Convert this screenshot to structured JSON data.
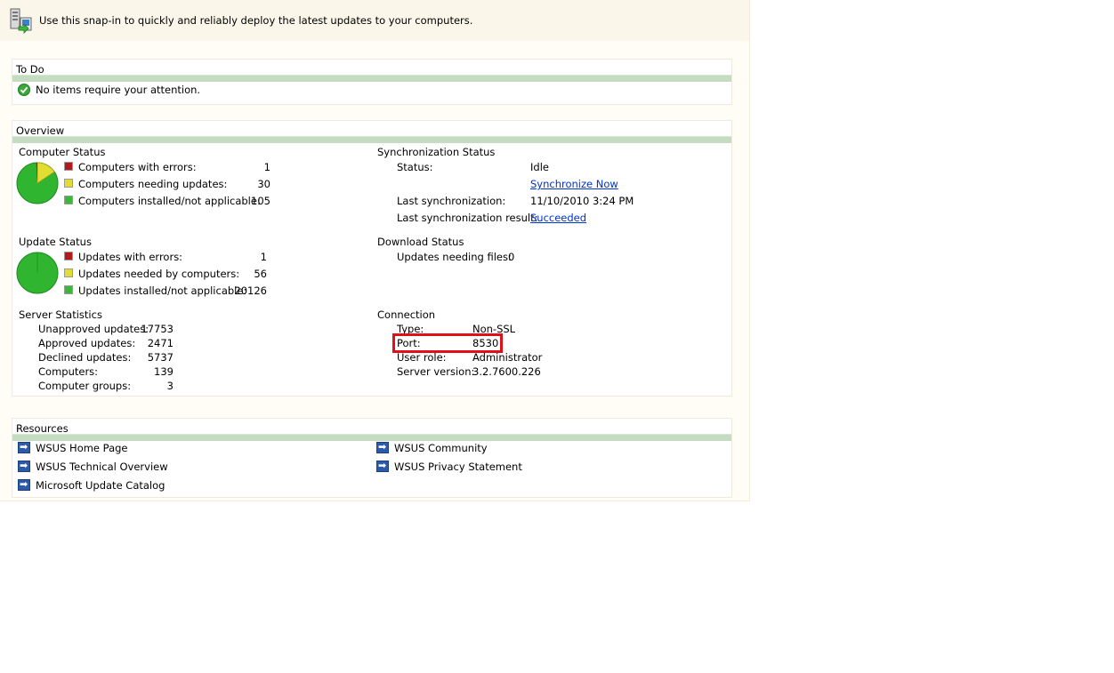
{
  "banner": {
    "text": "Use this snap-in to quickly and reliably deploy the latest updates to your computers."
  },
  "todo": {
    "title": "To Do",
    "message": "No items require your attention."
  },
  "overview": {
    "title": "Overview",
    "computer_status": {
      "title": "Computer Status",
      "items": [
        {
          "label": "Computers with errors:",
          "value": "1",
          "color": "#b01a1a"
        },
        {
          "label": "Computers needing updates:",
          "value": "30",
          "color": "#e3dc32"
        },
        {
          "label": "Computers installed/not applicable:",
          "value": "105",
          "color": "#3ab83a"
        }
      ]
    },
    "update_status": {
      "title": "Update Status",
      "items": [
        {
          "label": "Updates with errors:",
          "value": "1",
          "color": "#b01a1a"
        },
        {
          "label": "Updates needed by computers:",
          "value": "56",
          "color": "#e3dc32"
        },
        {
          "label": "Updates installed/not applicable:",
          "value": "20126",
          "color": "#3ab83a"
        }
      ]
    },
    "server_statistics": {
      "title": "Server Statistics",
      "items": [
        {
          "label": "Unapproved updates:",
          "value": "17753"
        },
        {
          "label": "Approved updates:",
          "value": "2471"
        },
        {
          "label": "Declined updates:",
          "value": "5737"
        },
        {
          "label": "Computers:",
          "value": "139"
        },
        {
          "label": "Computer groups:",
          "value": "3"
        }
      ]
    },
    "sync_status": {
      "title": "Synchronization Status",
      "status_label": "Status:",
      "status_value": "Idle",
      "sync_now": "Synchronize Now",
      "last_sync_label": "Last synchronization:",
      "last_sync_value": "11/10/2010 3:24 PM",
      "last_result_label": "Last synchronization result:",
      "last_result_value": "Succeeded"
    },
    "download_status": {
      "title": "Download Status",
      "needing_label": "Updates needing files:",
      "needing_value": "0"
    },
    "connection": {
      "title": "Connection",
      "items": [
        {
          "label": "Type:",
          "value": "Non-SSL"
        },
        {
          "label": "Port:",
          "value": "8530"
        },
        {
          "label": "User role:",
          "value": "Administrator"
        },
        {
          "label": "Server version:",
          "value": "3.2.7600.226"
        }
      ],
      "highlight_color": "#e01018"
    }
  },
  "resources": {
    "title": "Resources",
    "links": [
      "WSUS Home Page",
      "WSUS Technical Overview",
      "Microsoft Update Catalog",
      "WSUS Community",
      "WSUS Privacy Statement"
    ]
  }
}
